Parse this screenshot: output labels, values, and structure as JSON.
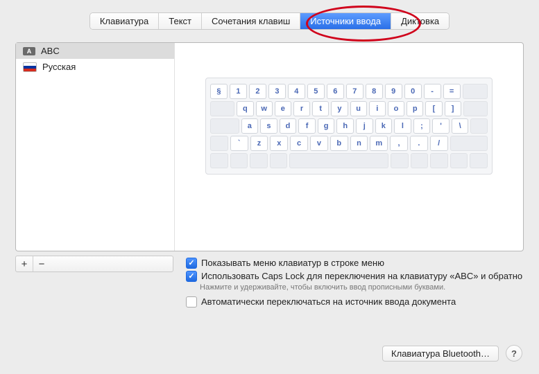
{
  "tabs": {
    "keyboard": "Клавиатура",
    "text": "Текст",
    "shortcuts": "Сочетания клавиш",
    "input_sources": "Источники ввода",
    "dictation": "Диктовка",
    "active": "input_sources"
  },
  "sources": [
    {
      "name": "ABC",
      "flag": "a",
      "selected": true
    },
    {
      "name": "Русская",
      "flag": "ru",
      "selected": false
    }
  ],
  "keyboard_layout": {
    "row1": [
      "§",
      "1",
      "2",
      "3",
      "4",
      "5",
      "6",
      "7",
      "8",
      "9",
      "0",
      "-",
      "="
    ],
    "row2": [
      "q",
      "w",
      "e",
      "r",
      "t",
      "y",
      "u",
      "i",
      "o",
      "p",
      "[",
      "]"
    ],
    "row3": [
      "a",
      "s",
      "d",
      "f",
      "g",
      "h",
      "j",
      "k",
      "l",
      ";",
      "'",
      "\\"
    ],
    "row4": [
      "`",
      "z",
      "x",
      "c",
      "v",
      "b",
      "n",
      "m",
      ",",
      ".",
      "/"
    ]
  },
  "add_label": "+",
  "remove_label": "−",
  "options": {
    "show_menu": {
      "checked": true,
      "label": "Показывать меню клавиатур в строке меню"
    },
    "caps_lock": {
      "checked": true,
      "label": "Использовать Caps Lock для переключения на клавиатуру «ABC» и обратно",
      "hint": "Нажмите и удерживайте, чтобы включить ввод прописными буквами."
    },
    "auto_switch": {
      "checked": false,
      "label": "Автоматически переключаться на источник ввода документа"
    }
  },
  "bluetooth_button": "Клавиатура Bluetooth…",
  "help_label": "?"
}
